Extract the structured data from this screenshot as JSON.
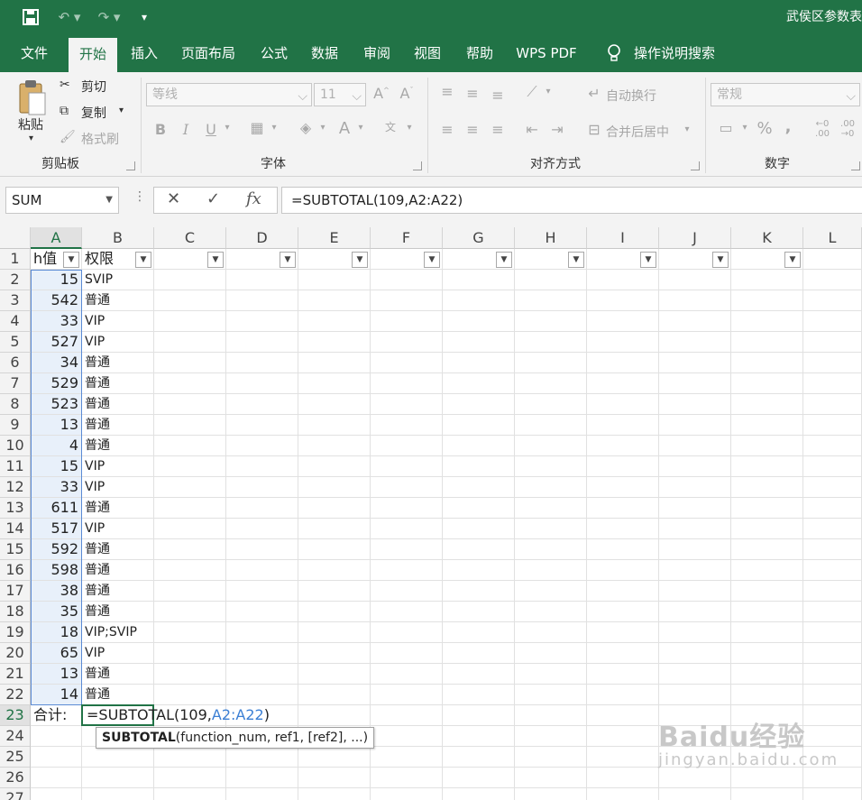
{
  "title_bar": {
    "doc_title": "武侯区参数表"
  },
  "tabs": [
    {
      "label": "文件"
    },
    {
      "label": "开始"
    },
    {
      "label": "插入"
    },
    {
      "label": "页面布局"
    },
    {
      "label": "公式"
    },
    {
      "label": "数据"
    },
    {
      "label": "审阅"
    },
    {
      "label": "视图"
    },
    {
      "label": "帮助"
    },
    {
      "label": "WPS PDF"
    },
    {
      "label": "操作说明搜索"
    }
  ],
  "ribbon": {
    "clipboard": {
      "paste": "粘贴",
      "cut": "剪切",
      "copy": "复制",
      "format_painter": "格式刷",
      "label": "剪贴板"
    },
    "font": {
      "font_name": "等线",
      "font_size": "11",
      "bold": "B",
      "italic": "I",
      "underline": "U",
      "label": "字体"
    },
    "alignment": {
      "wrap": "自动换行",
      "merge": "合并后居中",
      "label": "对齐方式"
    },
    "number": {
      "format": "常规",
      "percent": "%",
      "comma": ",",
      "label": "数字"
    }
  },
  "formula_bar": {
    "name_box": "SUM",
    "formula": "=SUBTOTAL(109,A2:A22)"
  },
  "columns": [
    "A",
    "B",
    "C",
    "D",
    "E",
    "F",
    "G",
    "H",
    "I",
    "J",
    "K",
    "L"
  ],
  "rows": [
    "1",
    "2",
    "3",
    "4",
    "5",
    "6",
    "7",
    "8",
    "9",
    "10",
    "11",
    "12",
    "13",
    "14",
    "15",
    "16",
    "17",
    "18",
    "19",
    "20",
    "21",
    "22",
    "23",
    "24",
    "25",
    "26",
    "27"
  ],
  "header_row": {
    "a": "h值",
    "b": "权限"
  },
  "data_rows": [
    {
      "a": "15",
      "b": "SVIP"
    },
    {
      "a": "542",
      "b": "普通"
    },
    {
      "a": "33",
      "b": "VIP"
    },
    {
      "a": "527",
      "b": "VIP"
    },
    {
      "a": "34",
      "b": "普通"
    },
    {
      "a": "529",
      "b": "普通"
    },
    {
      "a": "523",
      "b": "普通"
    },
    {
      "a": "13",
      "b": "普通"
    },
    {
      "a": "4",
      "b": "普通"
    },
    {
      "a": "15",
      "b": "VIP"
    },
    {
      "a": "33",
      "b": "VIP"
    },
    {
      "a": "611",
      "b": "普通"
    },
    {
      "a": "517",
      "b": "VIP"
    },
    {
      "a": "592",
      "b": "普通"
    },
    {
      "a": "598",
      "b": "普通"
    },
    {
      "a": "38",
      "b": "普通"
    },
    {
      "a": "35",
      "b": "普通"
    },
    {
      "a": "18",
      "b": "VIP;SVIP"
    },
    {
      "a": "65",
      "b": "VIP"
    },
    {
      "a": "13",
      "b": "普通"
    },
    {
      "a": "14",
      "b": "普通"
    }
  ],
  "total_row": {
    "label": "合计:",
    "editing_prefix": "=SUBTOTAL(109,",
    "editing_ref": "A2:A22",
    "editing_suffix": ")"
  },
  "tooltip": {
    "func": "SUBTOTAL",
    "args": "(function_num, ref1, [ref2], ...)"
  },
  "watermark": {
    "main": "Baidu经验",
    "sub": "jingyan.baidu.com"
  },
  "colors": {
    "excel_green": "#217346",
    "selection_blue": "#5b8bd5",
    "ref_blue": "#3b7fd4"
  }
}
